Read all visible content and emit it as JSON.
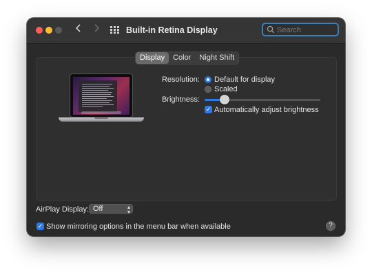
{
  "window": {
    "title": "Built-in Retina Display",
    "search_placeholder": "Search"
  },
  "toolbar": {
    "back_icon": "chevron-left-icon",
    "forward_icon": "chevron-right-icon",
    "grid_icon": "show-all-grid-icon"
  },
  "tabs": [
    {
      "label": "Display",
      "active": true
    },
    {
      "label": "Color",
      "active": false
    },
    {
      "label": "Night Shift",
      "active": false
    }
  ],
  "display": {
    "resolution_label": "Resolution:",
    "resolution_options": [
      {
        "label": "Default for display",
        "selected": true
      },
      {
        "label": "Scaled",
        "selected": false
      }
    ],
    "brightness_label": "Brightness:",
    "brightness_fraction": 0.17,
    "auto_brightness_label": "Automatically adjust brightness",
    "auto_brightness_checked": true
  },
  "airplay": {
    "label": "AirPlay Display:",
    "value": "Off"
  },
  "mirroring": {
    "label": "Show mirroring options in the menu bar when available",
    "checked": true
  },
  "help": {
    "label": "?"
  },
  "colors": {
    "accent": "#2f7ae5",
    "window_bg": "#2a2a2a",
    "close": "#ff5f57",
    "minimize": "#febc2e"
  }
}
